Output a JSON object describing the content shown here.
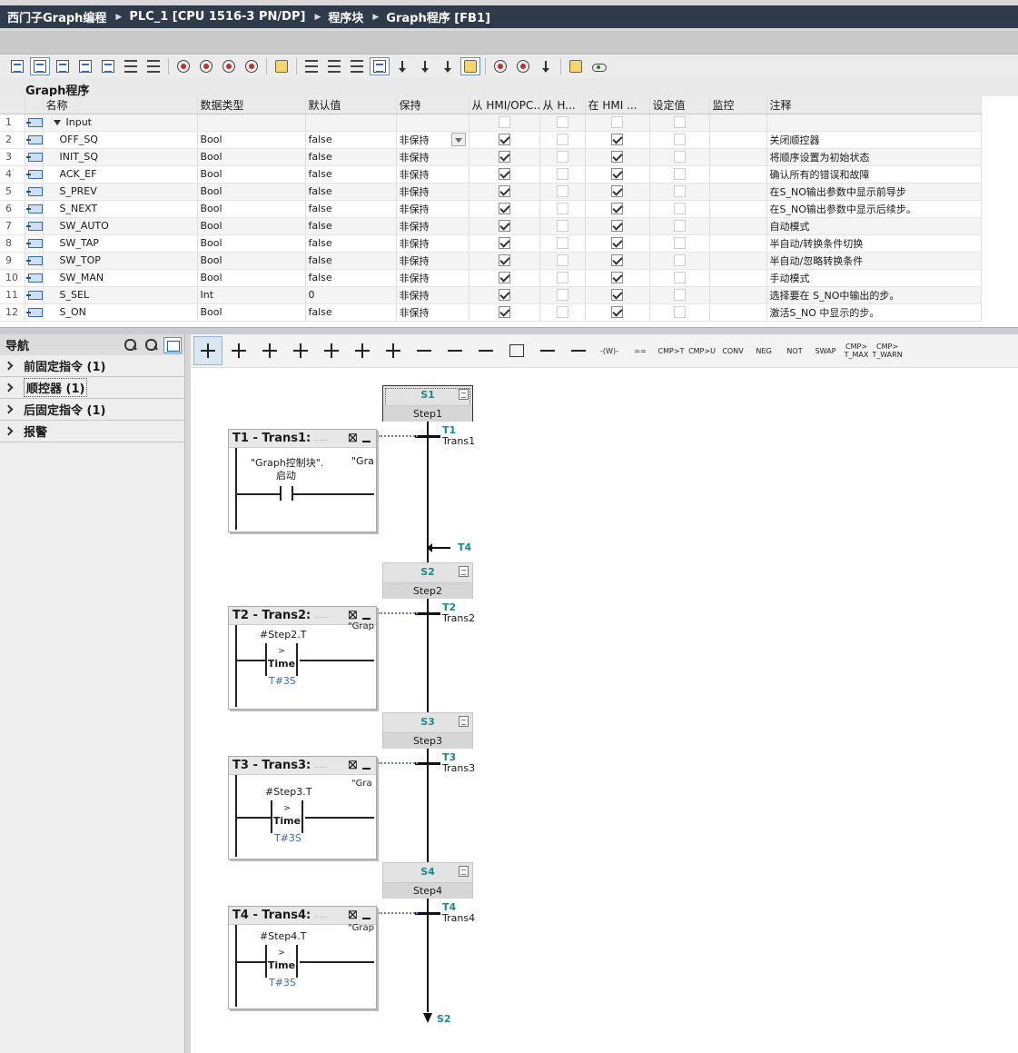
{
  "breadcrumb": [
    "西门子Graph编程",
    "PLC_1 [CPU 1516-3 PN/DP]",
    "程序块",
    "Graph程序 [FB1]"
  ],
  "interface_title": "Graph程序",
  "columns": [
    "名称",
    "数据类型",
    "默认值",
    "保持",
    "从 HMI/OPC...",
    "从 H...",
    "在 HMI ...",
    "设定值",
    "监控",
    "注释"
  ],
  "section_row": {
    "num": "1",
    "name": "Input"
  },
  "rows": [
    {
      "num": "2",
      "name": "OFF_SQ",
      "type": "Bool",
      "default": "false",
      "retain": "非保持",
      "comment": "关闭顺控器"
    },
    {
      "num": "3",
      "name": "INIT_SQ",
      "type": "Bool",
      "default": "false",
      "retain": "非保持",
      "comment": "将顺序设置为初始状态"
    },
    {
      "num": "4",
      "name": "ACK_EF",
      "type": "Bool",
      "default": "false",
      "retain": "非保持",
      "comment": "确认所有的错误和故障"
    },
    {
      "num": "5",
      "name": "S_PREV",
      "type": "Bool",
      "default": "false",
      "retain": "非保持",
      "comment": "在S_NO输出参数中显示前导步"
    },
    {
      "num": "6",
      "name": "S_NEXT",
      "type": "Bool",
      "default": "false",
      "retain": "非保持",
      "comment": "在S_NO输出参数中显示后续步。"
    },
    {
      "num": "7",
      "name": "SW_AUTO",
      "type": "Bool",
      "default": "false",
      "retain": "非保持",
      "comment": "自动模式"
    },
    {
      "num": "8",
      "name": "SW_TAP",
      "type": "Bool",
      "default": "false",
      "retain": "非保持",
      "comment": "半自动/转换条件切换"
    },
    {
      "num": "9",
      "name": "SW_TOP",
      "type": "Bool",
      "default": "false",
      "retain": "非保持",
      "comment": "半自动/忽略转换条件"
    },
    {
      "num": "10",
      "name": "SW_MAN",
      "type": "Bool",
      "default": "false",
      "retain": "非保持",
      "comment": "手动模式"
    },
    {
      "num": "11",
      "name": "S_SEL",
      "type": "Int",
      "default": "0",
      "retain": "非保持",
      "comment": "选择要在 S_NO中输出的步。"
    },
    {
      "num": "12",
      "name": "S_ON",
      "type": "Bool",
      "default": "false",
      "retain": "非保持",
      "comment": "激活S_NO 中显示的步。"
    }
  ],
  "nav": {
    "title": "导航",
    "items": [
      "前固定指令 (1)",
      "顺控器 (1)",
      "后固定指令 (1)",
      "报警"
    ]
  },
  "ladder_toolbar_text": [
    "CMP>T",
    "CMP>U",
    "CONV",
    "NEG",
    "NOT",
    "SWAP",
    "CMP>\nT_MAX",
    "CMP>\nT_WARN"
  ],
  "ladder_sym_text": {
    "wcoil": "-(W)-",
    "ltb_eq": "=="
  },
  "steps": [
    {
      "id": "S1",
      "name": "Step1"
    },
    {
      "id": "S2",
      "name": "Step2"
    },
    {
      "id": "S3",
      "name": "Step3"
    },
    {
      "id": "S4",
      "name": "Step4"
    }
  ],
  "transitions": [
    {
      "id": "T1",
      "name": "Trans1",
      "header": "T1 - Trans1:"
    },
    {
      "id": "T2",
      "name": "Trans2",
      "header": "T2 - Trans2:"
    },
    {
      "id": "T3",
      "name": "Trans3",
      "header": "T3 - Trans3:"
    },
    {
      "id": "T4",
      "name": "Trans4",
      "header": "T4 - Trans4:"
    }
  ],
  "trans_detail": {
    "t1_operand": "\"Graph控制块\".",
    "t1_operand2": "启动",
    "t1_side": "\"Gra",
    "t2_operand": "#Step2.T",
    "t3_operand": "#Step3.T",
    "t4_operand": "#Step4.T",
    "side_label": "\"Grap",
    "side_label_t3": "\"Gra",
    "cmp_op": ">",
    "cmp_type": "Time",
    "preset": "T#3S",
    "dotted": ".....",
    "close_glyph": "⛝"
  },
  "jump_in": "T4",
  "jump_out": "S2"
}
